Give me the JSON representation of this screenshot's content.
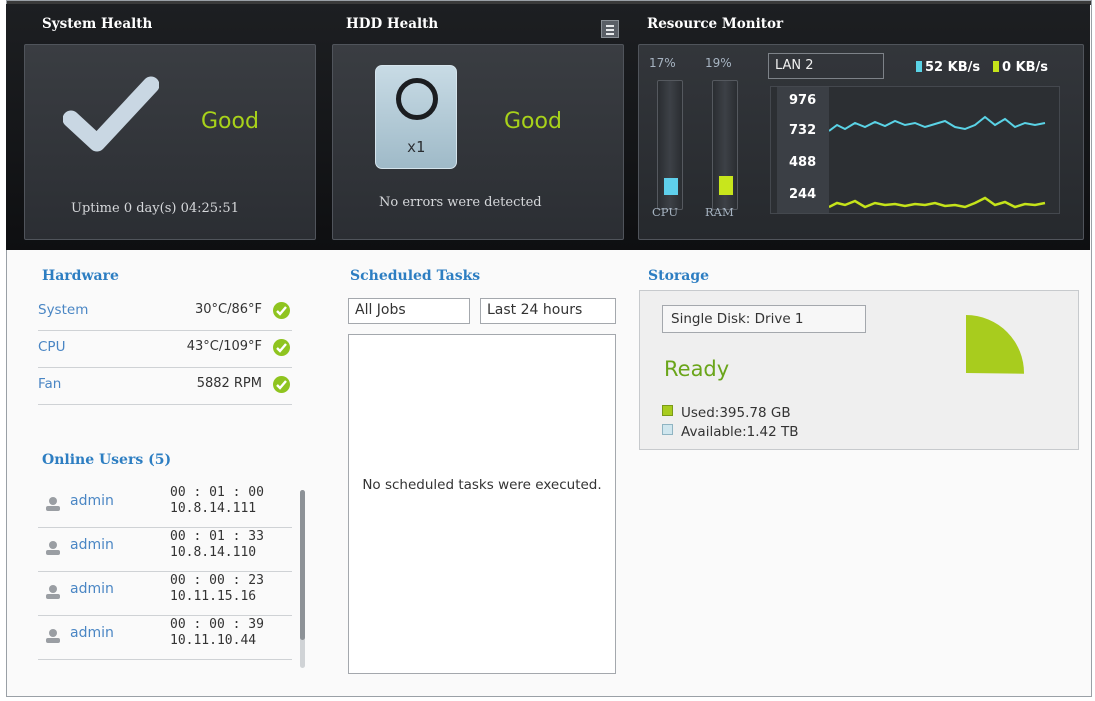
{
  "system_health": {
    "title": "System Health",
    "status": "Good",
    "uptime": "Uptime 0 day(s) 04:25:51"
  },
  "hdd_health": {
    "title": "HDD Health",
    "count": "x1",
    "status": "Good",
    "message": "No errors were detected"
  },
  "resource_monitor": {
    "title": "Resource Monitor",
    "cpu": {
      "percent_label": "17%",
      "label": "CPU",
      "value": 17
    },
    "ram": {
      "percent_label": "19%",
      "label": "RAM",
      "value": 19
    },
    "lan_select": "LAN 2",
    "upload_rate": "52 KB/s",
    "download_rate": "0 KB/s",
    "y_ticks": [
      "976",
      "732",
      "488",
      "244"
    ],
    "colors": {
      "upload_line": "#5ad3e6",
      "download_line": "#c5e31a",
      "cpu_bar": "#5fd0ec",
      "ram_bar": "#c8e61c"
    }
  },
  "hardware": {
    "title": "Hardware",
    "rows": [
      {
        "label": "System",
        "value": "30°C/86°F"
      },
      {
        "label": "CPU",
        "value": "43°C/109°F"
      },
      {
        "label": "Fan",
        "value": "5882 RPM"
      }
    ]
  },
  "online_users": {
    "title": "Online Users (5)",
    "users": [
      {
        "name": "admin",
        "time": "00 : 01 : 00",
        "ip": "10.8.14.111"
      },
      {
        "name": "admin",
        "time": "00 : 01 : 33",
        "ip": "10.8.14.110"
      },
      {
        "name": "admin",
        "time": "00 : 00 : 23",
        "ip": "10.11.15.16"
      },
      {
        "name": "admin",
        "time": "00 : 00 : 39",
        "ip": "10.11.10.44"
      }
    ]
  },
  "scheduled_tasks": {
    "title": "Scheduled Tasks",
    "job_filter": "All Jobs",
    "time_filter": "Last 24 hours",
    "empty_message": "No scheduled tasks were executed."
  },
  "storage": {
    "title": "Storage",
    "disk": "Single Disk: Drive  1",
    "status": "Ready",
    "used": "Used:395.78 GB",
    "available": "Available:1.42 TB",
    "used_fraction": 0.21,
    "colors": {
      "used": "#a8cc1e",
      "available": "#cfe6ee"
    }
  }
}
